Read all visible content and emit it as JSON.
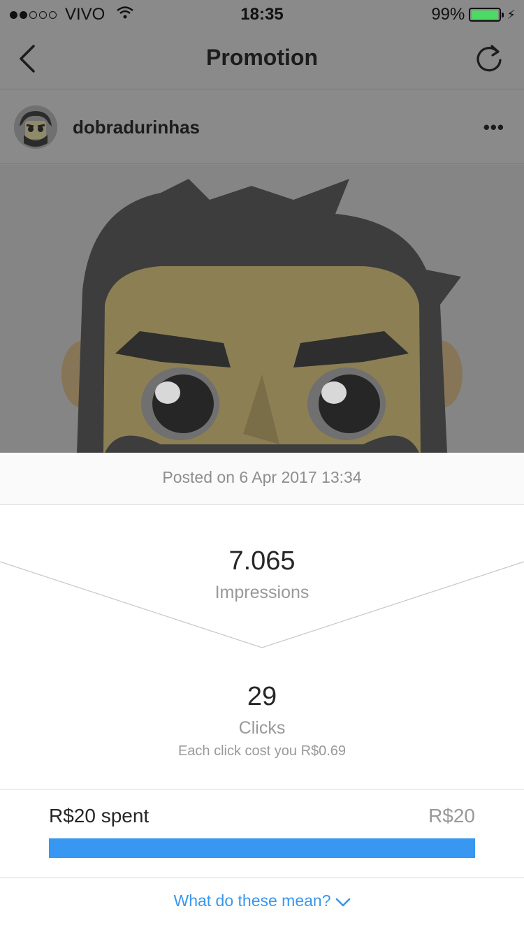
{
  "status_bar": {
    "carrier": "VIVO",
    "time": "18:35",
    "battery": "99%",
    "battery_level": 0.99,
    "signal_bars_filled": 2,
    "signal_bars_total": 5
  },
  "nav": {
    "title": "Promotion",
    "back_icon": "chevron-left-icon",
    "refresh_icon": "refresh-icon"
  },
  "post": {
    "username": "dobradurinhas",
    "more_icon": "more-dots-icon",
    "posted_on": "Posted on 6 Apr 2017 13:34"
  },
  "stats": {
    "impressions_value": "7.065",
    "impressions_label": "Impressions",
    "clicks_value": "29",
    "clicks_label": "Clicks",
    "click_cost": "Each click cost you R$0.69"
  },
  "budget": {
    "spent": "R$20 spent",
    "total": "R$20",
    "progress": 1.0
  },
  "help": {
    "label": "What do these mean?",
    "icon": "chevron-down-icon"
  },
  "colors": {
    "accent": "#3897f0",
    "overlay": "#8a8a8a",
    "battery": "#4cd964"
  }
}
